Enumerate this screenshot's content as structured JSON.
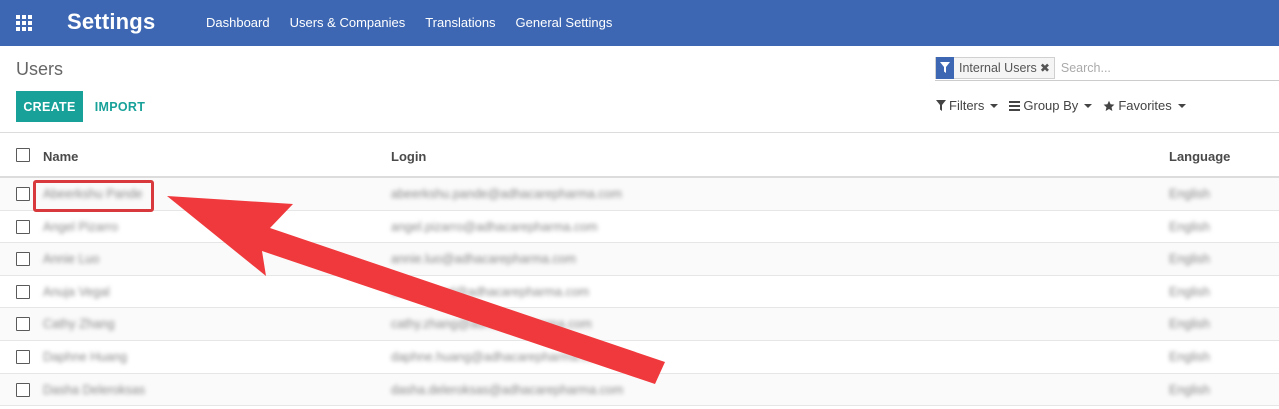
{
  "navbar": {
    "app_title": "Settings",
    "apps_icon": "grid-icon",
    "menu": [
      "Dashboard",
      "Users & Companies",
      "Translations",
      "General Settings"
    ],
    "color": "#3d67b2"
  },
  "control_panel": {
    "breadcrumb": "Users",
    "create_label": "CREATE",
    "import_label": "IMPORT",
    "accent_color": "#17a199",
    "search": {
      "facet_label": "Internal Users",
      "facet_icon": "filter-icon",
      "placeholder": "Search..."
    },
    "filters_label": "Filters",
    "group_by_label": "Group By",
    "favorites_label": "Favorites"
  },
  "table": {
    "columns": [
      "Name",
      "Login",
      "Language"
    ],
    "rows": [
      {
        "name": "Abeerkshu Pande",
        "login": "abeerkshu.pande@adhacarepharma.com",
        "language": "English"
      },
      {
        "name": "Angel Pizarro",
        "login": "angel.pizarro@adhacarepharma.com",
        "language": "English"
      },
      {
        "name": "Annie Luo",
        "login": "annie.luo@adhacarepharma.com",
        "language": "English"
      },
      {
        "name": "Anuja Vegal",
        "login": "anuja.vegal@adhacarepharma.com",
        "language": "English"
      },
      {
        "name": "Cathy Zhang",
        "login": "cathy.zhang@adhacarepharma.com",
        "language": "English"
      },
      {
        "name": "Daphne Huang",
        "login": "daphne.huang@adhacarepharma.com",
        "language": "English"
      },
      {
        "name": "Dasha Deleroksas",
        "login": "dasha.deleroksas@adhacarepharma.com",
        "language": "English"
      }
    ]
  },
  "annotation": {
    "highlight_color": "#d8393c",
    "arrow_color": "#f0393c"
  }
}
